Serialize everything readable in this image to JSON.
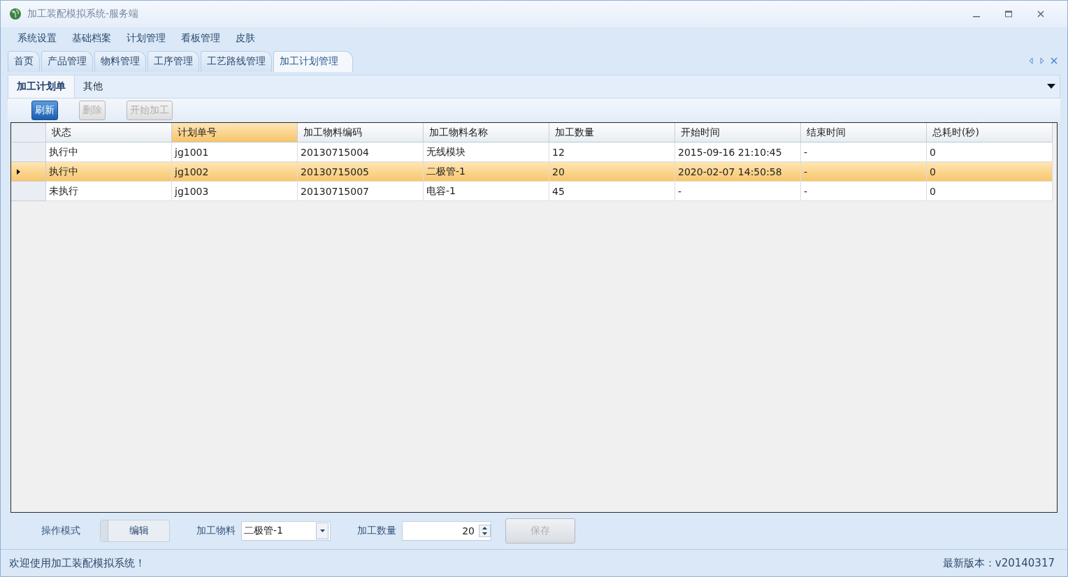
{
  "window": {
    "title": "加工装配模拟系统-服务端"
  },
  "menu": [
    "系统设置",
    "基础档案",
    "计划管理",
    "看板管理",
    "皮肤"
  ],
  "doc_tabs": [
    {
      "label": "首页",
      "selected": false
    },
    {
      "label": "产品管理",
      "selected": false
    },
    {
      "label": "物料管理",
      "selected": false
    },
    {
      "label": "工序管理",
      "selected": false
    },
    {
      "label": "工艺路线管理",
      "selected": false
    },
    {
      "label": "加工计划管理",
      "selected": true
    }
  ],
  "ribbon_tabs": [
    {
      "label": "加工计划单",
      "selected": true
    },
    {
      "label": "其他",
      "selected": false
    }
  ],
  "toolbar": [
    {
      "label": "刷新",
      "disabled": false
    },
    {
      "label": "删除",
      "disabled": true
    },
    {
      "label": "开始加工",
      "disabled": true
    }
  ],
  "grid": {
    "columns": [
      {
        "label": "状态",
        "selected": false
      },
      {
        "label": "计划单号",
        "selected": true
      },
      {
        "label": "加工物料编码",
        "selected": false
      },
      {
        "label": "加工物料名称",
        "selected": false
      },
      {
        "label": "加工数量",
        "selected": false
      },
      {
        "label": "开始时间",
        "selected": false
      },
      {
        "label": "结束时间",
        "selected": false
      },
      {
        "label": "总耗时(秒)",
        "selected": false
      }
    ],
    "rows": [
      {
        "selected": false,
        "cells": [
          "执行中",
          "jg1001",
          "20130715004",
          "无线模块",
          "12",
          "2015-09-16 21:10:45",
          "-",
          "0"
        ]
      },
      {
        "selected": true,
        "cells": [
          "执行中",
          "jg1002",
          "20130715005",
          "二极管-1",
          "20",
          "2020-02-07 14:50:58",
          "-",
          "0"
        ]
      },
      {
        "selected": false,
        "cells": [
          "未执行",
          "jg1003",
          "20130715007",
          "电容-1",
          "45",
          "-",
          "-",
          "0"
        ]
      }
    ]
  },
  "form": {
    "mode_label": "操作模式",
    "mode_toggle": {
      "label": "编辑",
      "on": false
    },
    "material_label": "加工物料",
    "material_value": "二极管-1",
    "quantity_label": "加工数量",
    "quantity_value": "20",
    "save": {
      "label": "保存",
      "disabled": true
    }
  },
  "status_bar": {
    "message": "欢迎使用加工装配模拟系统！",
    "version": "最新版本：v20140317"
  }
}
